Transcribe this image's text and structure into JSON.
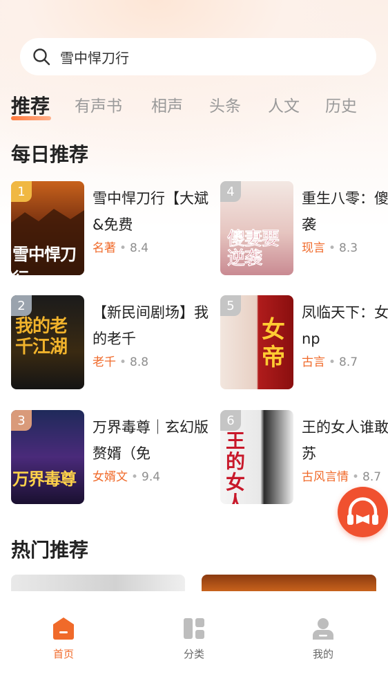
{
  "search": {
    "value": "雪中悍刀行"
  },
  "tabs": [
    {
      "label": "推荐",
      "active": true
    },
    {
      "label": "有声书"
    },
    {
      "label": "相声"
    },
    {
      "label": "头条"
    },
    {
      "label": "人文"
    },
    {
      "label": "历史"
    }
  ],
  "daily": {
    "title": "每日推荐",
    "books": [
      {
        "rank": "1",
        "title": "雪中悍刀行【大斌&免费",
        "genre": "名著",
        "score": "8.4",
        "cover_text": "雪中悍刀行"
      },
      {
        "rank": "2",
        "title": "【新民间剧场】我的老千",
        "genre": "老千",
        "score": "8.8",
        "cover_text": "我的老千江湖"
      },
      {
        "rank": "3",
        "title": "万界毒尊｜玄幻版赘婿（免",
        "genre": "女婿文",
        "score": "9.4",
        "cover_text": "万界毒尊"
      },
      {
        "rank": "4",
        "title": "重生八零：傻妻，要逆袭",
        "genre": "现言",
        "score": "8.3",
        "cover_text": "傻妻要逆袭"
      },
      {
        "rank": "5",
        "title": "凤临天下：女商丨女尊np",
        "genre": "古言",
        "score": "8.7",
        "cover_text": "女帝"
      },
      {
        "rank": "6",
        "title": "王的女人谁敢动｜一刀苏",
        "genre": "古风言情",
        "score": "8.7",
        "cover_text": "王的女人"
      }
    ]
  },
  "hot": {
    "title": "热门推荐"
  },
  "colors": {
    "accent": "#f06a2a",
    "fab": "#f0512f"
  },
  "nav": [
    {
      "label": "首页",
      "icon": "home-icon",
      "active": true
    },
    {
      "label": "分类",
      "icon": "category-icon"
    },
    {
      "label": "我的",
      "icon": "profile-icon"
    }
  ]
}
